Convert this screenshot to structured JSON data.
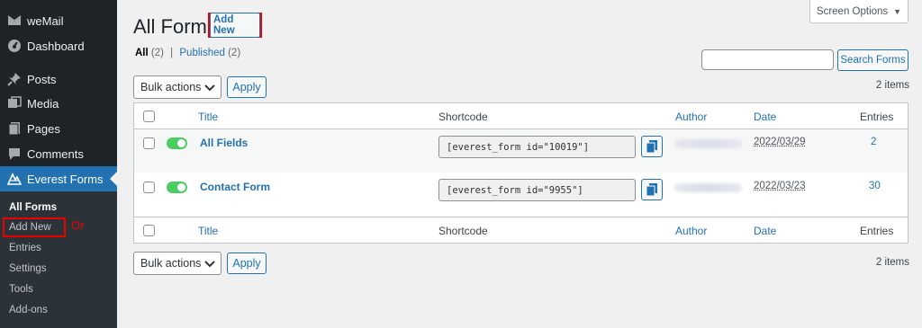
{
  "sidebar": {
    "menu": [
      {
        "label": "weMail",
        "icon": "wemail-icon"
      },
      {
        "label": "Dashboard",
        "icon": "dashboard-icon"
      },
      {
        "label": "Posts",
        "icon": "pin-icon"
      },
      {
        "label": "Media",
        "icon": "media-icon"
      },
      {
        "label": "Pages",
        "icon": "pages-icon"
      },
      {
        "label": "Comments",
        "icon": "comments-icon"
      },
      {
        "label": "Everest Forms",
        "icon": "everest-forms-icon"
      }
    ],
    "submenu": [
      "All Forms",
      "Add New",
      "Entries",
      "Settings",
      "Tools",
      "Add-ons"
    ],
    "or_label": "Or"
  },
  "header": {
    "title": "All Forms",
    "add_new": "Add New",
    "screen_options": "Screen Options"
  },
  "filters": {
    "all_label": "All",
    "all_count": "(2)",
    "separator": "|",
    "published_label": "Published",
    "published_count": "(2)"
  },
  "search": {
    "value": "",
    "button": "Search Forms"
  },
  "bulk": {
    "label": "Bulk actions",
    "apply": "Apply",
    "count": "2 items"
  },
  "table": {
    "columns": [
      "Title",
      "Shortcode",
      "Author",
      "Date",
      "Entries"
    ],
    "rows": [
      {
        "title": "All Fields",
        "shortcode": "[everest_form id=\"10019\"]",
        "date": "2022/03/29",
        "entries": "2",
        "enabled": true
      },
      {
        "title": "Contact Form",
        "shortcode": "[everest_form id=\"9955\"]",
        "date": "2022/03/23",
        "entries": "30",
        "enabled": true
      }
    ]
  },
  "colors": {
    "sidebar": "#1d2327",
    "accent": "#2271b1",
    "highlight": "#e00000",
    "toggle_on": "#4bce61"
  }
}
